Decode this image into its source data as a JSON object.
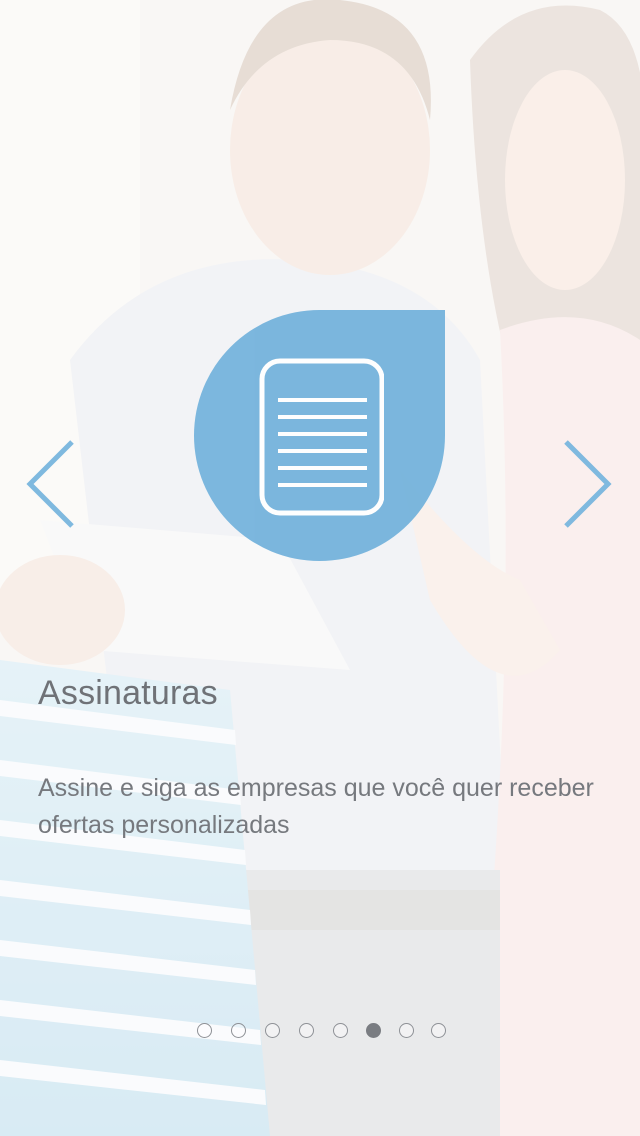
{
  "onboarding": {
    "title": "Assinaturas",
    "description": "Assine e siga as empresas que você quer receber ofertas personalizadas",
    "badge_icon": "document-icon",
    "prev_icon": "chevron-left-icon",
    "next_icon": "chevron-right-icon"
  },
  "pagination": {
    "total": 8,
    "current_index": 5
  },
  "colors": {
    "accent": "#75b3dc",
    "title_text": "#6f7277",
    "body_text": "#76797e",
    "dot_active": "#7a7d82"
  }
}
